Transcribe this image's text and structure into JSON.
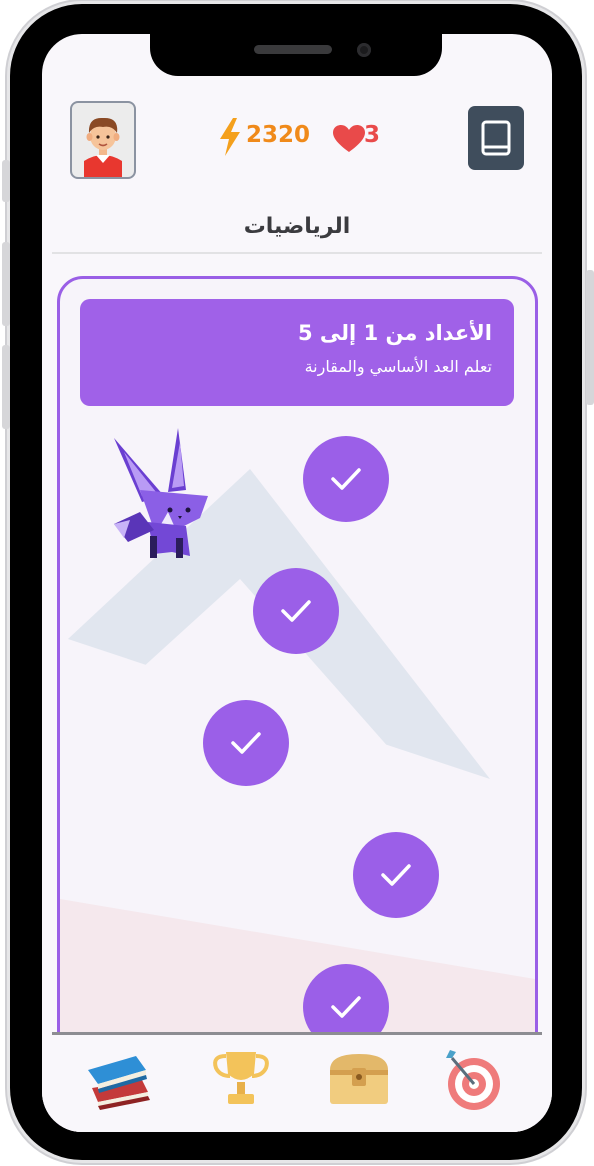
{
  "header": {
    "energy_value": "2320",
    "lives_value": "3",
    "energy_icon": "lightning-bolt-icon",
    "lives_icon": "heart-icon",
    "avatar_icon": "boy-avatar-icon",
    "book_icon": "book-icon"
  },
  "subject_title": "الرياضيات",
  "unit": {
    "title": "الأعداد من 1 إلى 5",
    "subtitle": "تعلم العد الأساسي والمقارنة"
  },
  "lessons": [
    {
      "status": "completed",
      "icon": "check-icon"
    },
    {
      "status": "completed",
      "icon": "check-icon"
    },
    {
      "status": "completed",
      "icon": "check-icon"
    },
    {
      "status": "completed",
      "icon": "check-icon"
    },
    {
      "status": "completed",
      "icon": "check-icon"
    }
  ],
  "bottom_nav": [
    {
      "icon": "books-icon",
      "active": true
    },
    {
      "icon": "trophy-icon",
      "active": false
    },
    {
      "icon": "treasure-chest-icon",
      "active": false
    },
    {
      "icon": "target-icon",
      "active": false
    }
  ],
  "colors": {
    "accent": "#9b5fe8",
    "energy": "#f08a1a",
    "lives": "#e94a4a"
  }
}
